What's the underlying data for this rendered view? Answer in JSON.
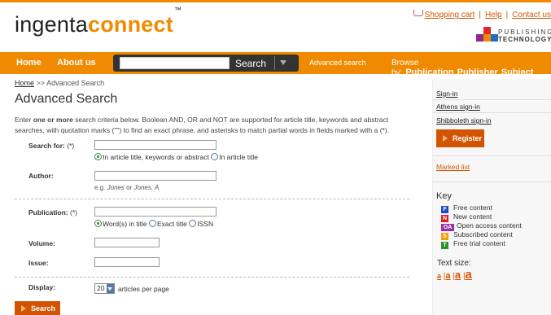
{
  "header": {
    "logo_a": "ingenta",
    "logo_b": "connect",
    "tm": "™",
    "links": {
      "cart": "Shopping cart",
      "help": "Help",
      "contact": "Contact us"
    },
    "partner": {
      "line1": "PUBLISHING",
      "line2": "TECHNOLOGY"
    }
  },
  "nav": {
    "home": "Home",
    "about": "About us",
    "search_button": "Search",
    "advanced": "Advanced search",
    "browse_label": "Browse by:",
    "browse_publication": "Publication",
    "browse_publisher": "Publisher",
    "browse_subject": "Subject"
  },
  "breadcrumb": {
    "home": "Home",
    "sep": ">>",
    "current": "Advanced Search"
  },
  "page_title": "Advanced Search",
  "intro": {
    "p1": "Enter ",
    "b1": "one or more",
    "p2": " search criteria below. Boolean AND, OR and NOT are supported for article title, keywords and abstract searches, with quotation marks (\"\") to find an exact phrase, and asterisks to match partial words in fields marked with a (*)."
  },
  "form": {
    "search_for": {
      "label": "Search for:",
      "req": "(*)",
      "value": "",
      "opt1": "In article title, keywords or abstract",
      "opt2": "In article title"
    },
    "author": {
      "label": "Author:",
      "value": "",
      "hint_pre": "e.g. ",
      "hint_a": "Jones",
      "hint_mid": " or ",
      "hint_b": "Jones, A"
    },
    "publication": {
      "label": "Publication:",
      "req": "(*)",
      "value": "",
      "opt1": "Word(s) in title",
      "opt2": "Exact title",
      "opt3": "ISSN"
    },
    "volume": {
      "label": "Volume:",
      "value": ""
    },
    "issue": {
      "label": "Issue:",
      "value": ""
    },
    "display": {
      "label": "Display:",
      "selected": "20",
      "suffix": "articles per page"
    },
    "submit": "Search"
  },
  "sidebar": {
    "signin": "Sign-in",
    "athens": "Athens sign-in",
    "shibboleth": "Shibboleth sign-in",
    "register": "Register",
    "marked_list": "Marked list",
    "key_title": "Key",
    "key": [
      {
        "icon": "F",
        "label": "Free content",
        "color": "#1f4fbf"
      },
      {
        "icon": "N",
        "label": "New content",
        "color": "#d92020"
      },
      {
        "icon": "OA",
        "label": "Open access content",
        "color": "#9b2fa8"
      },
      {
        "icon": "S",
        "label": "Subscribed content",
        "color": "#f0a000"
      },
      {
        "icon": "T",
        "label": "Free trial content",
        "color": "#2f8f2f"
      }
    ],
    "text_size_label": "Text size:",
    "text_sizes": [
      "a",
      "a",
      "a",
      "a"
    ],
    "text_size_sep": "|"
  },
  "colors": {
    "accent": "#f08a00",
    "button": "#d35400",
    "link": "#d35400"
  }
}
